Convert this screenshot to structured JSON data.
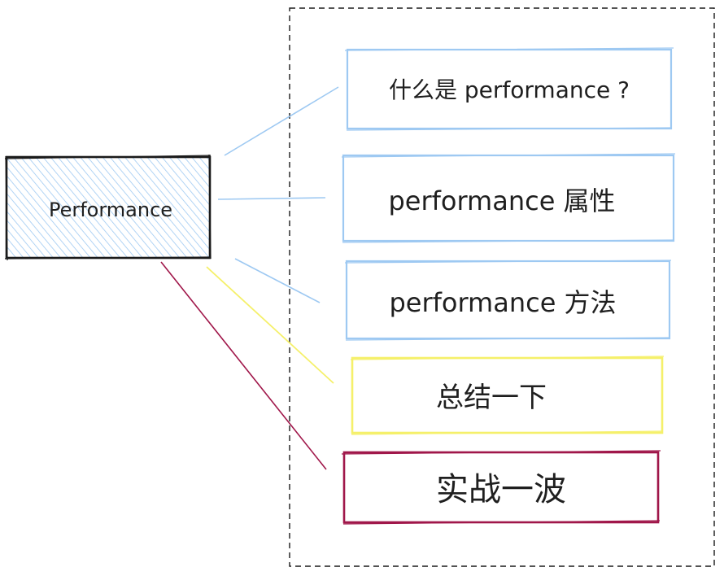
{
  "root": {
    "label": "Performance"
  },
  "items": [
    {
      "label": "什么是 performance ?",
      "color": "#9ec9f2"
    },
    {
      "label": "performance 属性",
      "color": "#9ec9f2"
    },
    {
      "label": "performance 方法",
      "color": "#9ec9f2"
    },
    {
      "label": "总结一下",
      "color": "#f5f06a"
    },
    {
      "label": "实战一波",
      "color": "#a0174a"
    }
  ],
  "colors": {
    "root_fill": "#9ec9f2",
    "stroke_dark": "#1a1a1a",
    "dashed_frame": "#1a1a1a"
  }
}
